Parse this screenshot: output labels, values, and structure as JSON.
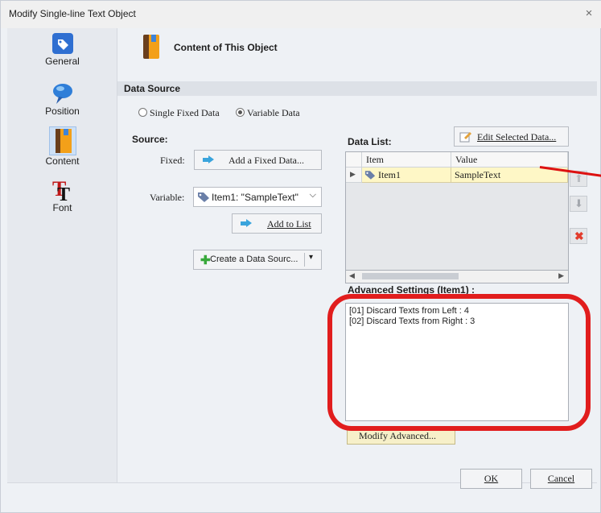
{
  "window": {
    "title": "Modify Single-line Text Object",
    "close": "×"
  },
  "sidebar": {
    "items": [
      {
        "label": "General",
        "icon": "general-tag-icon"
      },
      {
        "label": "Position",
        "icon": "position-pin-icon"
      },
      {
        "label": "Content",
        "icon": "content-book-icon",
        "selected": true
      },
      {
        "label": "Font",
        "icon": "font-icon"
      }
    ]
  },
  "header": {
    "title": "Content of This Object"
  },
  "data_source": {
    "label": "Data Source",
    "options": [
      "Single Fixed Data",
      "Variable Data"
    ],
    "selected": "Variable Data"
  },
  "source": {
    "label": "Source:",
    "fixed_label": "Fixed:",
    "add_fixed_button": "Add a Fixed Data...",
    "variable_label": "Variable:",
    "variable_value": "Item1: \"SampleText\"",
    "add_to_list_button": "Add to List",
    "create_source_button": "Create a Data Sourc..."
  },
  "data_list": {
    "label": "Data List:",
    "edit_button": "Edit Selected Data...",
    "columns": [
      "Item",
      "Value"
    ],
    "rows": [
      {
        "item": "Item1",
        "value": "SampleText"
      }
    ]
  },
  "advanced": {
    "label": "Advanced Settings (Item1) :",
    "lines": [
      "[01] Discard Texts from Left : 4",
      "[02] Discard Texts from Right : 3"
    ],
    "modify_button": "Modify Advanced..."
  },
  "footer": {
    "ok": "OK",
    "cancel": "Cancel"
  },
  "colors": {
    "highlight": "#e11d1d",
    "row_selected": "#fef7c6",
    "accent": "#3aa4dc"
  }
}
